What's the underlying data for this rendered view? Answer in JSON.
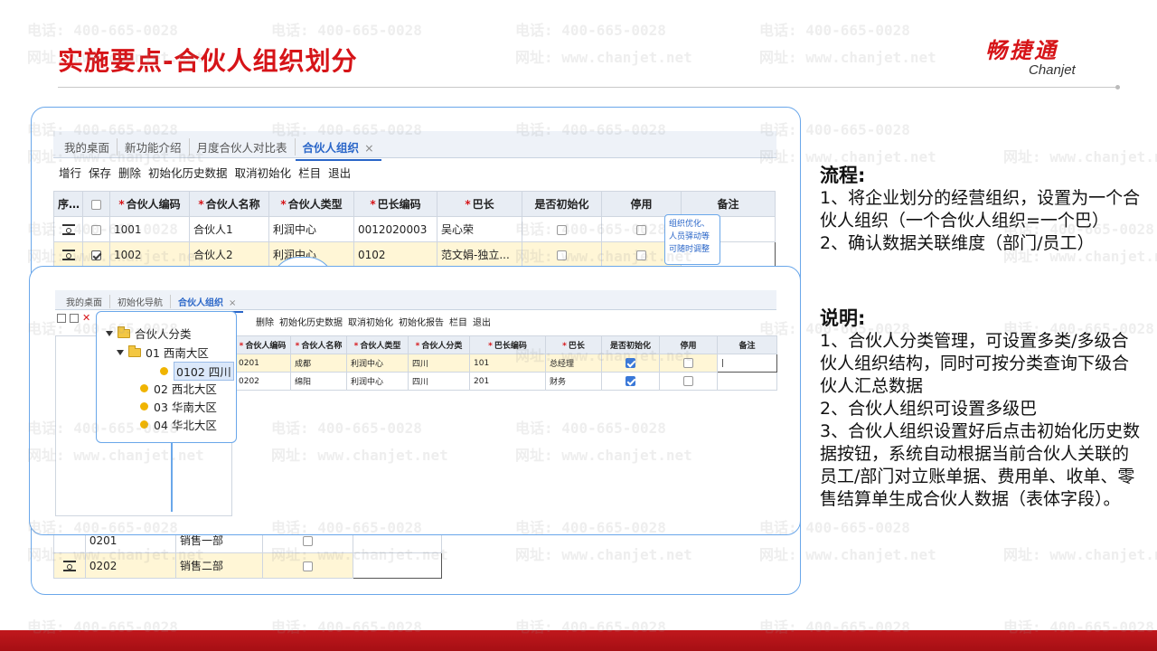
{
  "header": {
    "title": "实施要点-合伙人组织划分"
  },
  "logo": {
    "cn": "畅捷通",
    "en": "Chanjet"
  },
  "watermark": {
    "phone": "电话: 400-665-0028",
    "site": "网址: www.chanjet.net"
  },
  "back": {
    "tabs": [
      {
        "label": "我的桌面"
      },
      {
        "label": "新功能介绍"
      },
      {
        "label": "月度合伙人对比表"
      },
      {
        "label": "合伙人组织"
      }
    ],
    "close": "×",
    "toolbar": [
      "增行",
      "保存",
      "删除",
      "初始化历史数据",
      "取消初始化",
      "栏目",
      "退出"
    ],
    "columns": [
      {
        "label": "序号",
        "req": ""
      },
      {
        "label": "",
        "req": ""
      },
      {
        "label": "合伙人编码",
        "req": "*"
      },
      {
        "label": "合伙人名称",
        "req": "*"
      },
      {
        "label": "合伙人类型",
        "req": "*"
      },
      {
        "label": "巴长编码",
        "req": "*"
      },
      {
        "label": "巴长",
        "req": "*"
      },
      {
        "label": "是否初始化",
        "req": ""
      },
      {
        "label": "停用",
        "req": ""
      },
      {
        "label": "备注",
        "req": ""
      }
    ],
    "rows": [
      {
        "code": "1001",
        "name": "合伙人1",
        "type": "利润中心",
        "leader_code": "0012020003",
        "leader": "吴心荣"
      },
      {
        "code": "1002",
        "name": "合伙人2",
        "type": "利润中心",
        "leader_code": "0102",
        "leader": "范文娟-独立..."
      }
    ],
    "tooltip": [
      "组织优化、",
      "人员驿动等",
      "可随时调整"
    ],
    "bottom_rows": [
      {
        "code": "0201",
        "name": "销售一部"
      },
      {
        "code": "0202",
        "name": "销售二部"
      }
    ]
  },
  "front": {
    "tabs": [
      {
        "label": "我的桌面"
      },
      {
        "label": "初始化导航"
      },
      {
        "label": "合伙人组织"
      }
    ],
    "close": "×",
    "toolbar": [
      "删除",
      "初始化历史数据",
      "取消初始化",
      "初始化报告",
      "栏目",
      "退出"
    ],
    "columns": [
      {
        "label": "合伙人编码",
        "req": "*"
      },
      {
        "label": "合伙人名称",
        "req": "*"
      },
      {
        "label": "合伙人类型",
        "req": "*"
      },
      {
        "label": "合伙人分类",
        "req": "*"
      },
      {
        "label": "巴长编码",
        "req": "*"
      },
      {
        "label": "巴长",
        "req": "*"
      },
      {
        "label": "是否初始化",
        "req": ""
      },
      {
        "label": "停用",
        "req": ""
      },
      {
        "label": "备注",
        "req": ""
      }
    ],
    "rows": [
      {
        "code": "0201",
        "name": "成都",
        "type": "利润中心",
        "category": "四川",
        "leader_code": "101",
        "leader": "总经理"
      },
      {
        "code": "0202",
        "name": "绵阳",
        "type": "利润中心",
        "category": "四川",
        "leader_code": "201",
        "leader": "财务"
      }
    ]
  },
  "tree": {
    "root": "合伙人分类",
    "group": "01 西南大区",
    "selected": "0102 四川",
    "items": [
      "02 西北大区",
      "03 华南大区",
      "04 华北大区"
    ]
  },
  "right": {
    "process_title": "流程:",
    "process": [
      "1、将企业划分的经营组织，设置为一个合伙人组织（一个合伙人组织=一个巴）",
      "2、确认数据关联维度（部门/员工）"
    ],
    "notes_title": "说明:",
    "notes": [
      "1、合伙人分类管理，可设置多类/多级合伙人组织结构，同时可按分类查询下级合伙人汇总数据",
      "2、合伙人组织可设置多级巴",
      "3、合伙人组织设置好后点击初始化历史数据按钮，系统自动根据当前合伙人关联的员工/部门对立账单据、费用单、收单、零售结算单生成合伙人数据（表体字段）。"
    ]
  }
}
